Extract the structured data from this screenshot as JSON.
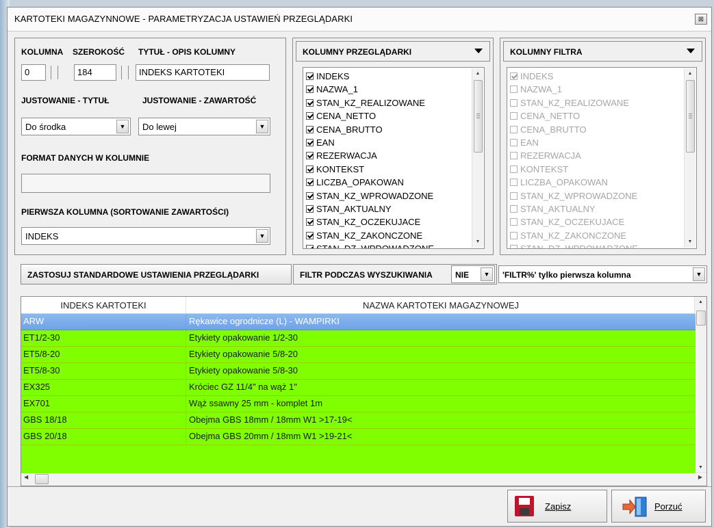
{
  "window": {
    "title": "KARTOTEKI MAGAZYNNOWE - PARAMETRYZACJA USTAWIEŃ PRZEGLĄDARKI",
    "close_glyph": "⊠"
  },
  "settings": {
    "col_label": "KOLUMNA",
    "width_label": "SZEROKOŚĆ",
    "title_label": "TYTUŁ - OPIS KOLUMNY",
    "col_value": "0",
    "width_value": "184",
    "title_value": "INDEKS KARTOTEKI",
    "align_title_label": "JUSTOWANIE - TYTUŁ",
    "align_content_label": "JUSTOWANIE - ZAWARTOŚĆ",
    "align_title_value": "Do środka",
    "align_content_value": "Do lewej",
    "format_label": "FORMAT DANYCH W KOLUMNIE",
    "format_value": "",
    "first_col_label": "PIERWSZA KOLUMNA (SORTOWANIE ZAWARTOŚCI)",
    "first_col_value": "INDEKS"
  },
  "browser_columns": {
    "header": "KOLUMNY PRZEGLĄDARKI",
    "items": [
      "INDEKS",
      "NAZWA_1",
      "STAN_KZ_REALIZOWANE",
      "CENA_NETTO",
      "CENA_BRUTTO",
      "EAN",
      "REZERWACJA",
      "KONTEKST",
      "LICZBA_OPAKOWAN",
      "STAN_KZ_WPROWADZONE",
      "STAN_AKTUALNY",
      "STAN_KZ_OCZEKUJACE",
      "STAN_KZ_ZAKONCZONE",
      "STAN_DZ_WPROWADZONE"
    ],
    "checked": [
      true,
      true,
      true,
      true,
      true,
      true,
      true,
      true,
      true,
      true,
      true,
      true,
      true,
      true
    ]
  },
  "filter_columns": {
    "header": "KOLUMNY FILTRA",
    "items": [
      "INDEKS",
      "NAZWA_1",
      "STAN_KZ_REALIZOWANE",
      "CENA_NETTO",
      "CENA_BRUTTO",
      "EAN",
      "REZERWACJA",
      "KONTEKST",
      "LICZBA_OPAKOWAN",
      "STAN_KZ_WPROWADZONE",
      "STAN_AKTUALNY",
      "STAN_KZ_OCZEKUJACE",
      "STAN_KZ_ZAKONCZONE",
      "STAN_DZ_WPROWADZONE"
    ],
    "checked": [
      true,
      false,
      false,
      false,
      false,
      false,
      false,
      false,
      false,
      false,
      false,
      false,
      false,
      false
    ]
  },
  "toolbar": {
    "apply_defaults_label": "ZASTOSUJ STANDARDOWE USTAWIENIA PRZEGLĄDARKI",
    "filter_search_label": "FILTR PODCZAS WYSZUKIWANIA",
    "filter_search_value": "NIE",
    "filter_mode_value": "'FILTR%' tylko pierwsza kolumna"
  },
  "grid": {
    "headers": [
      "INDEKS KARTOTEKI",
      "NAZWA KARTOTEKI MAGAZYNOWEJ"
    ],
    "rows": [
      [
        "ARW",
        "Rękawice ogrodnicze (L) -  WAMPIRKI"
      ],
      [
        "ET1/2-30",
        "Etykiety opakowanie 1/2-30"
      ],
      [
        "ET5/8-20",
        "Etykiety opakowanie 5/8-20"
      ],
      [
        "ET5/8-30",
        "Etykiety opakowanie 5/8-30"
      ],
      [
        "EX325",
        "Króciec GZ 11/4\" na wąż 1\""
      ],
      [
        "EX701",
        "Wąż ssawny 25 mm - komplet 1m"
      ],
      [
        "GBS  18/18",
        "Obejma GBS   18mm / 18mm W1 >17-19<"
      ],
      [
        "GBS  20/18",
        "Obejma GBS   20mm / 18mm W1 >19-21<"
      ]
    ],
    "selected_index": 0,
    "row_color": "#7fff00",
    "selected_color": "#7aacec"
  },
  "actions": {
    "save_label": "Zapisz",
    "cancel_label": "Porzuć"
  }
}
